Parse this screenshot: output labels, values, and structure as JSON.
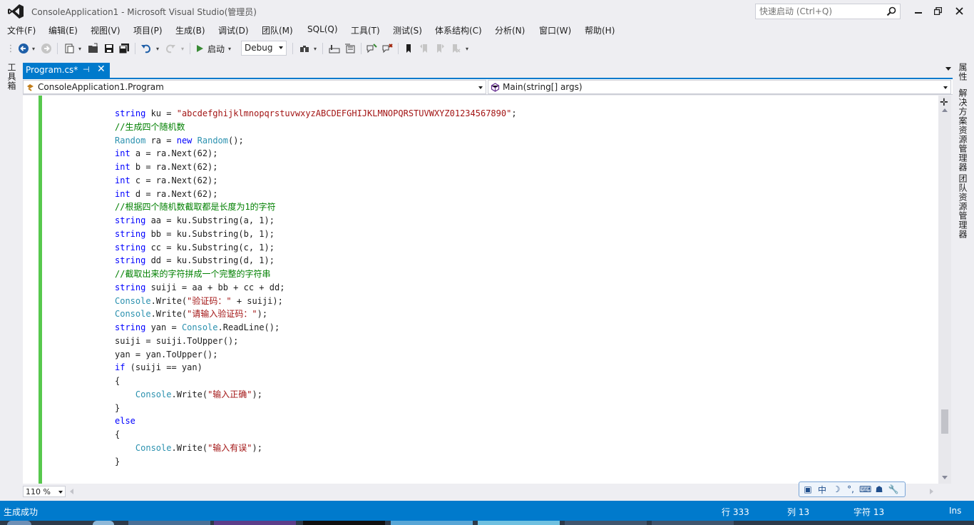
{
  "window": {
    "title": "ConsoleApplication1 - Microsoft Visual Studio(管理员)",
    "quick_launch_placeholder": "快速启动 (Ctrl+Q)"
  },
  "menu": [
    "文件(F)",
    "编辑(E)",
    "视图(V)",
    "项目(P)",
    "生成(B)",
    "调试(D)",
    "团队(M)",
    "SQL(Q)",
    "工具(T)",
    "测试(S)",
    "体系结构(C)",
    "分析(N)",
    "窗口(W)",
    "帮助(H)"
  ],
  "toolbar": {
    "start_label": "启动",
    "config_value": "Debug"
  },
  "side_panels": {
    "left": "工具箱",
    "right": [
      "属性",
      "解决方案资源管理器",
      "团队资源管理器"
    ]
  },
  "tab": {
    "label": "Program.cs*"
  },
  "navbar": {
    "type_value": "ConsoleApplication1.Program",
    "member_value": "Main(string[] args)"
  },
  "code_lines": [
    [
      {
        "t": "string",
        "c": "kw"
      },
      {
        "t": " ku = ",
        "c": ""
      },
      {
        "t": "\"abcdefghijklmnopqrstuvwxyzABCDEFGHIJKLMNOPQRSTUVWXYZ01234567890\"",
        "c": "str"
      },
      {
        "t": ";",
        "c": ""
      }
    ],
    [
      {
        "t": "//生成四个随机数",
        "c": "cm"
      }
    ],
    [
      {
        "t": "Random",
        "c": "ty"
      },
      {
        "t": " ra = ",
        "c": ""
      },
      {
        "t": "new",
        "c": "kw"
      },
      {
        "t": " ",
        "c": ""
      },
      {
        "t": "Random",
        "c": "ty"
      },
      {
        "t": "();",
        "c": ""
      }
    ],
    [
      {
        "t": "int",
        "c": "kw"
      },
      {
        "t": " a = ra.Next(62);",
        "c": ""
      }
    ],
    [
      {
        "t": "int",
        "c": "kw"
      },
      {
        "t": " b = ra.Next(62);",
        "c": ""
      }
    ],
    [
      {
        "t": "int",
        "c": "kw"
      },
      {
        "t": " c = ra.Next(62);",
        "c": ""
      }
    ],
    [
      {
        "t": "int",
        "c": "kw"
      },
      {
        "t": " d = ra.Next(62);",
        "c": ""
      }
    ],
    [
      {
        "t": "//根据四个随机数截取都是长度为1的字符",
        "c": "cm"
      }
    ],
    [
      {
        "t": "string",
        "c": "kw"
      },
      {
        "t": " aa = ku.Substring(a, 1);",
        "c": ""
      }
    ],
    [
      {
        "t": "string",
        "c": "kw"
      },
      {
        "t": " bb = ku.Substring(b, 1);",
        "c": ""
      }
    ],
    [
      {
        "t": "string",
        "c": "kw"
      },
      {
        "t": " cc = ku.Substring(c, 1);",
        "c": ""
      }
    ],
    [
      {
        "t": "string",
        "c": "kw"
      },
      {
        "t": " dd = ku.Substring(d, 1);",
        "c": ""
      }
    ],
    [
      {
        "t": "//截取出来的字符拼成一个完整的字符串",
        "c": "cm"
      }
    ],
    [
      {
        "t": "string",
        "c": "kw"
      },
      {
        "t": " suiji = aa + bb + cc + dd;",
        "c": ""
      }
    ],
    [
      {
        "t": "Console",
        "c": "ty"
      },
      {
        "t": ".Write(",
        "c": ""
      },
      {
        "t": "\"验证码：\"",
        "c": "str"
      },
      {
        "t": " + suiji);",
        "c": ""
      }
    ],
    [
      {
        "t": "Console",
        "c": "ty"
      },
      {
        "t": ".Write(",
        "c": ""
      },
      {
        "t": "\"请输入验证码：\"",
        "c": "str"
      },
      {
        "t": ");",
        "c": ""
      }
    ],
    [
      {
        "t": "string",
        "c": "kw"
      },
      {
        "t": " yan = ",
        "c": ""
      },
      {
        "t": "Console",
        "c": "ty"
      },
      {
        "t": ".ReadLine();",
        "c": ""
      }
    ],
    [
      {
        "t": "suiji = suiji.ToUpper();",
        "c": ""
      }
    ],
    [
      {
        "t": "yan = yan.ToUpper();",
        "c": ""
      }
    ],
    [
      {
        "t": "if",
        "c": "kw"
      },
      {
        "t": " (suiji == yan)",
        "c": ""
      }
    ],
    [
      {
        "t": "{",
        "c": ""
      }
    ],
    [
      {
        "t": "    ",
        "c": ""
      },
      {
        "t": "Console",
        "c": "ty"
      },
      {
        "t": ".Write(",
        "c": ""
      },
      {
        "t": "\"输入正确\"",
        "c": "str"
      },
      {
        "t": ");",
        "c": ""
      }
    ],
    [
      {
        "t": "}",
        "c": ""
      }
    ],
    [
      {
        "t": "else",
        "c": "kw"
      }
    ],
    [
      {
        "t": "{",
        "c": ""
      }
    ],
    [
      {
        "t": "    ",
        "c": ""
      },
      {
        "t": "Console",
        "c": "ty"
      },
      {
        "t": ".Write(",
        "c": ""
      },
      {
        "t": "\"输入有误\"",
        "c": "str"
      },
      {
        "t": ");",
        "c": ""
      }
    ],
    [
      {
        "t": "}",
        "c": ""
      }
    ]
  ],
  "zoom": "110 %",
  "ime": {
    "mode": "中"
  },
  "status": {
    "message": "生成成功",
    "line": "行 333",
    "col": "列 13",
    "char": "字符 13",
    "mode": "Ins"
  },
  "colors": {
    "accent": "#007acc",
    "keyword": "#0000ff",
    "type": "#2b91af",
    "string": "#a31515",
    "comment": "#008000",
    "changed_margin": "#57c84d"
  }
}
